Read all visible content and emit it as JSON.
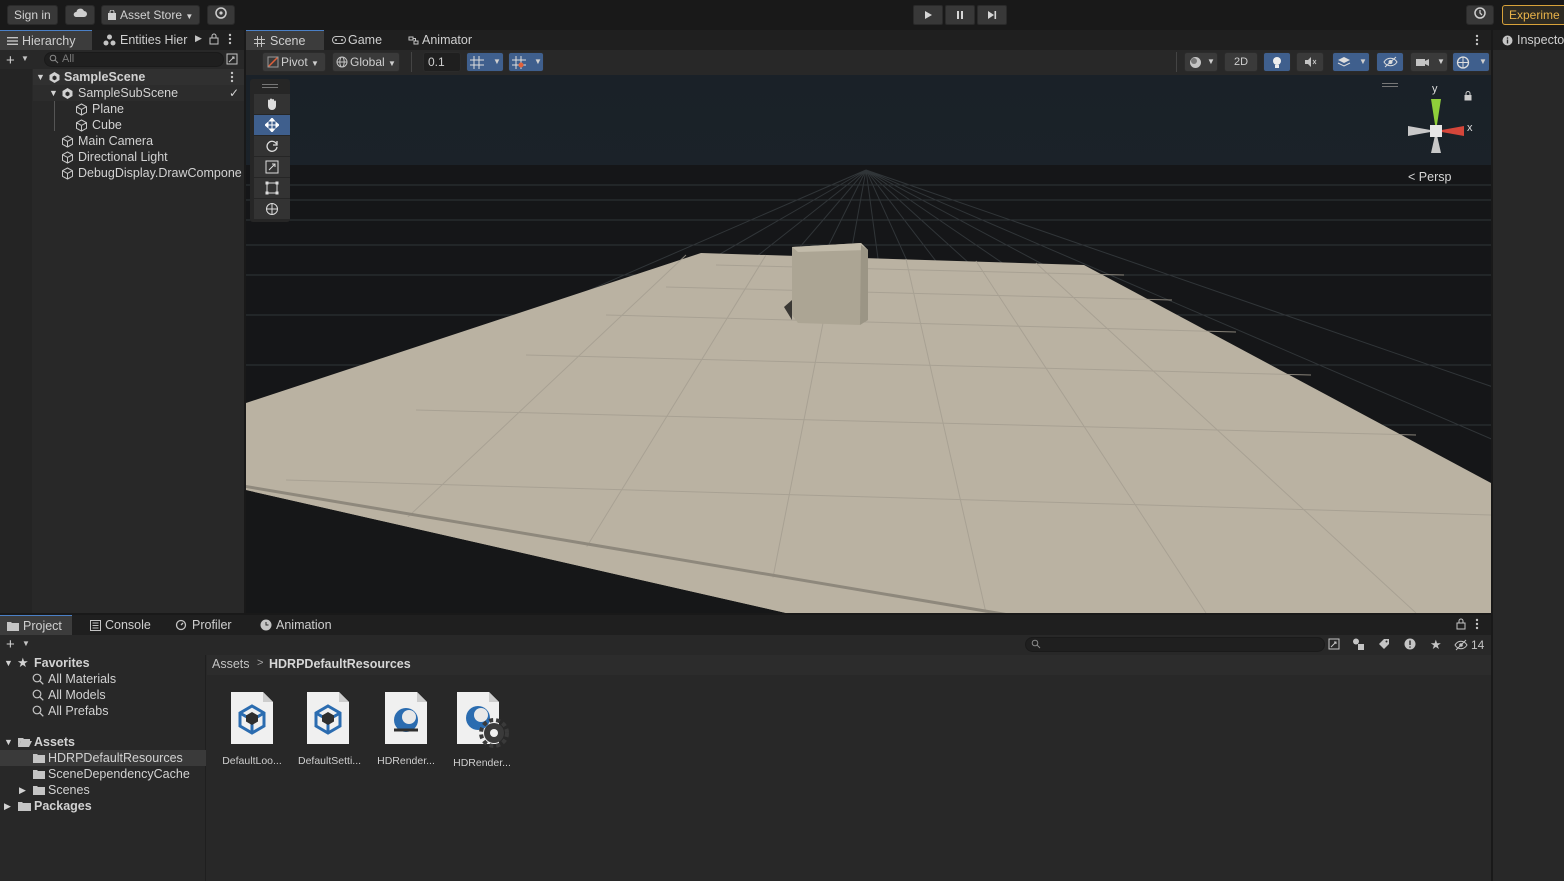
{
  "topbar": {
    "sign_in": "Sign in",
    "asset_store": "Asset Store",
    "experimental": "Experime"
  },
  "hierarchy": {
    "tabs": [
      "Hierarchy",
      "Entities Hier"
    ],
    "search_placeholder": "All",
    "scene": "SampleScene",
    "subscene": "SampleSubScene",
    "items": [
      "Plane",
      "Cube",
      "Main Camera",
      "Directional Light",
      "DebugDisplay.DrawCompone"
    ]
  },
  "scene_view": {
    "tabs": [
      "Scene",
      "Game",
      "Animator"
    ],
    "pivot": "Pivot",
    "global": "Global",
    "snap_value": "0.1",
    "mode_2d": "2D",
    "persp": "Persp",
    "gizmo_y": "y",
    "gizmo_x": "x"
  },
  "inspector": {
    "tab": "Inspecto"
  },
  "project": {
    "tabs": [
      "Project",
      "Console",
      "Profiler",
      "Animation"
    ],
    "hidden_count": "14",
    "favorites_label": "Favorites",
    "favorites": [
      "All Materials",
      "All Models",
      "All Prefabs"
    ],
    "assets_label": "Assets",
    "assets_children": [
      "HDRPDefaultResources",
      "SceneDependencyCache",
      "Scenes"
    ],
    "packages_label": "Packages",
    "breadcrumb": [
      "Assets",
      "HDRPDefaultResources"
    ],
    "files": [
      "DefaultLoo...",
      "DefaultSetti...",
      "HDRender...",
      "HDRender..."
    ]
  },
  "colors": {
    "accent": "#4b80c6",
    "selection": "#3f5f8d",
    "plane": "#bab2a2"
  }
}
